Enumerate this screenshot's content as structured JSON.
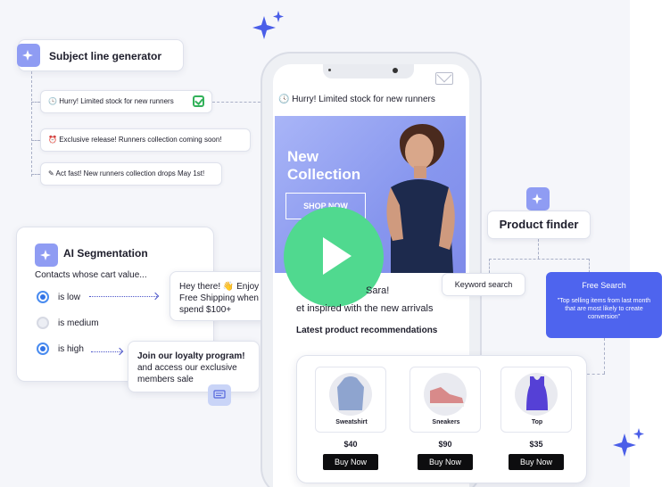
{
  "subject_generator": {
    "title": "Subject line generator",
    "options": [
      {
        "icon": "clock-emoji",
        "text": "Hurry! Limited stock for new runners",
        "selected": true
      },
      {
        "icon": "alarm-emoji",
        "text": "Exclusive release! Runners collection coming soon!"
      },
      {
        "icon": "pencil-emoji",
        "text": "Act fast! New runners collection drops May 1st!"
      }
    ]
  },
  "segmentation": {
    "title": "AI Segmentation",
    "subtitle": "Contacts whose cart value...",
    "options": [
      {
        "label": "is low",
        "checked": true
      },
      {
        "label": "is medium",
        "checked": false
      },
      {
        "label": "is high",
        "checked": true
      }
    ]
  },
  "bubbles": {
    "low_message": "Hey there! 👋 Enjoy a Free Shipping when you spend $100+",
    "high_title": "Join our loyalty program!",
    "high_body": "and access our exclusive members sale"
  },
  "phone": {
    "subject_line": "Hurry! Limited stock for new runners",
    "hero_title": "New Collection",
    "hero_cta": "SHOP NOW",
    "greeting": "Sara!",
    "inspired": "et inspired with the new arrivals",
    "latest": "Latest product recommendations"
  },
  "products": [
    {
      "name": "Sweatshirt",
      "price": "$40",
      "cta": "Buy Now",
      "icon": "sweatshirt-icon",
      "color": "#8ea4cf"
    },
    {
      "name": "Sneakers",
      "price": "$90",
      "cta": "Buy Now",
      "icon": "sneakers-icon",
      "color": "#d88a8a"
    },
    {
      "name": "Top",
      "price": "$35",
      "cta": "Buy Now",
      "icon": "tank-top-icon",
      "color": "#5540d6"
    }
  ],
  "product_finder": {
    "title": "Product finder",
    "keyword": "Keyword search",
    "free_search_title": "Free Search",
    "free_search_desc": "\"Top selling items from last month that are most likely to create conversion\""
  },
  "colors": {
    "accent": "#4e64ee",
    "ai_badge": "#8f9cf3",
    "play": "#50d98f",
    "sparkle": "#4a5ee8"
  }
}
